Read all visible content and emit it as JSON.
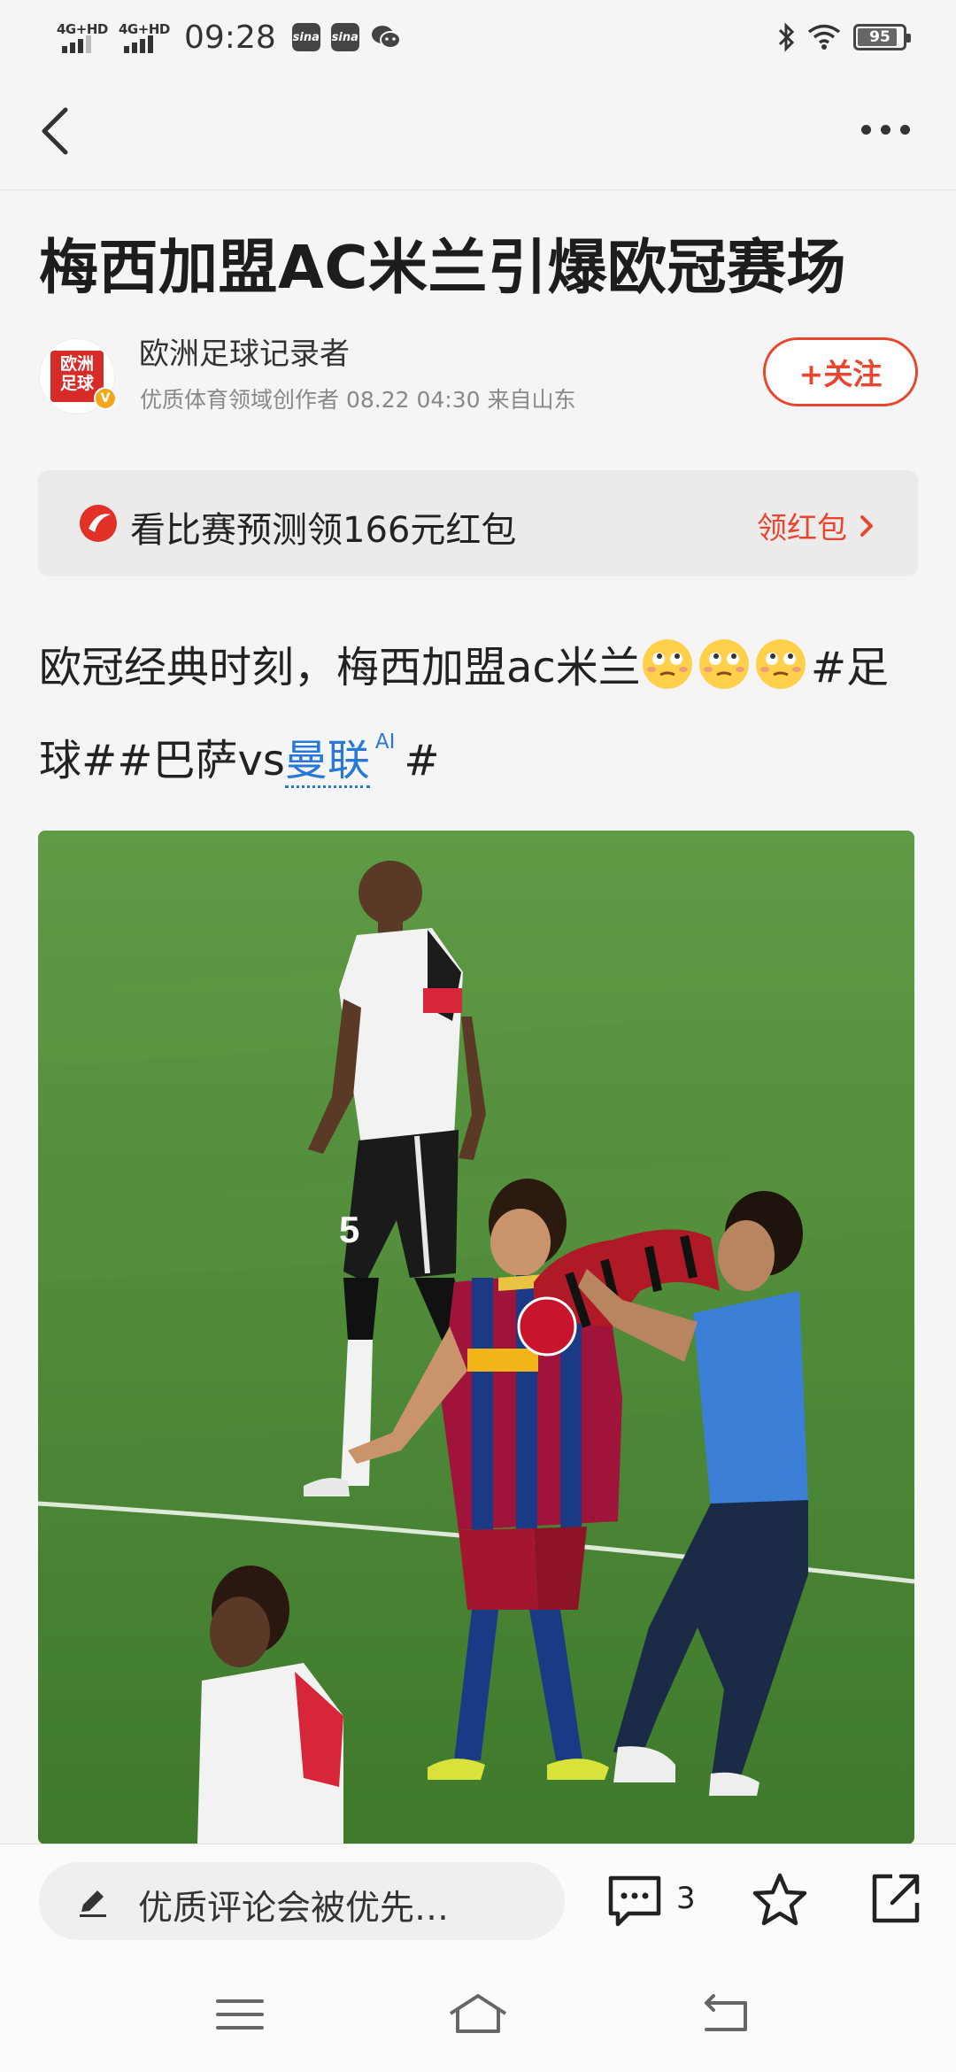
{
  "status_bar": {
    "sim1_label": "4G+HD",
    "sim2_label": "4G+HD",
    "time": "09:28",
    "app_badges": [
      "sina",
      "sina"
    ],
    "battery": "95",
    "icons": [
      "wechat-icon",
      "bluetooth-icon",
      "wifi-icon",
      "battery-icon"
    ]
  },
  "nav": {
    "back_icon": "chevron-left-icon",
    "more_icon": "more-dots-icon"
  },
  "article": {
    "title": "梅西加盟AC米兰引爆欧冠赛场",
    "author": {
      "avatar_text_line1": "欧洲",
      "avatar_text_line2": "足球",
      "verified_mark": "V",
      "name": "欧洲足球记录者",
      "meta": "优质体育领域创作者  08.22  04:30  来自山东",
      "follow_label": "+关注"
    },
    "promo": {
      "text": "看比赛预测领166元红包",
      "action": "领红包",
      "accent": "#e8462f"
    },
    "body": {
      "text_part1": "欧冠经典时刻，梅西加盟ac米兰",
      "text_part2": "#足球##巴萨vs",
      "link": "曼联",
      "ai_tag": "AI",
      "text_part3": "#"
    },
    "photo_alt_name": "messi-ac-milan-scarf-photo"
  },
  "bottom_bar": {
    "comment_placeholder": "优质评论会被优先…",
    "comment_count": "3"
  },
  "system_nav": {
    "icons": [
      "menu-icon",
      "home-icon",
      "back-icon"
    ]
  }
}
